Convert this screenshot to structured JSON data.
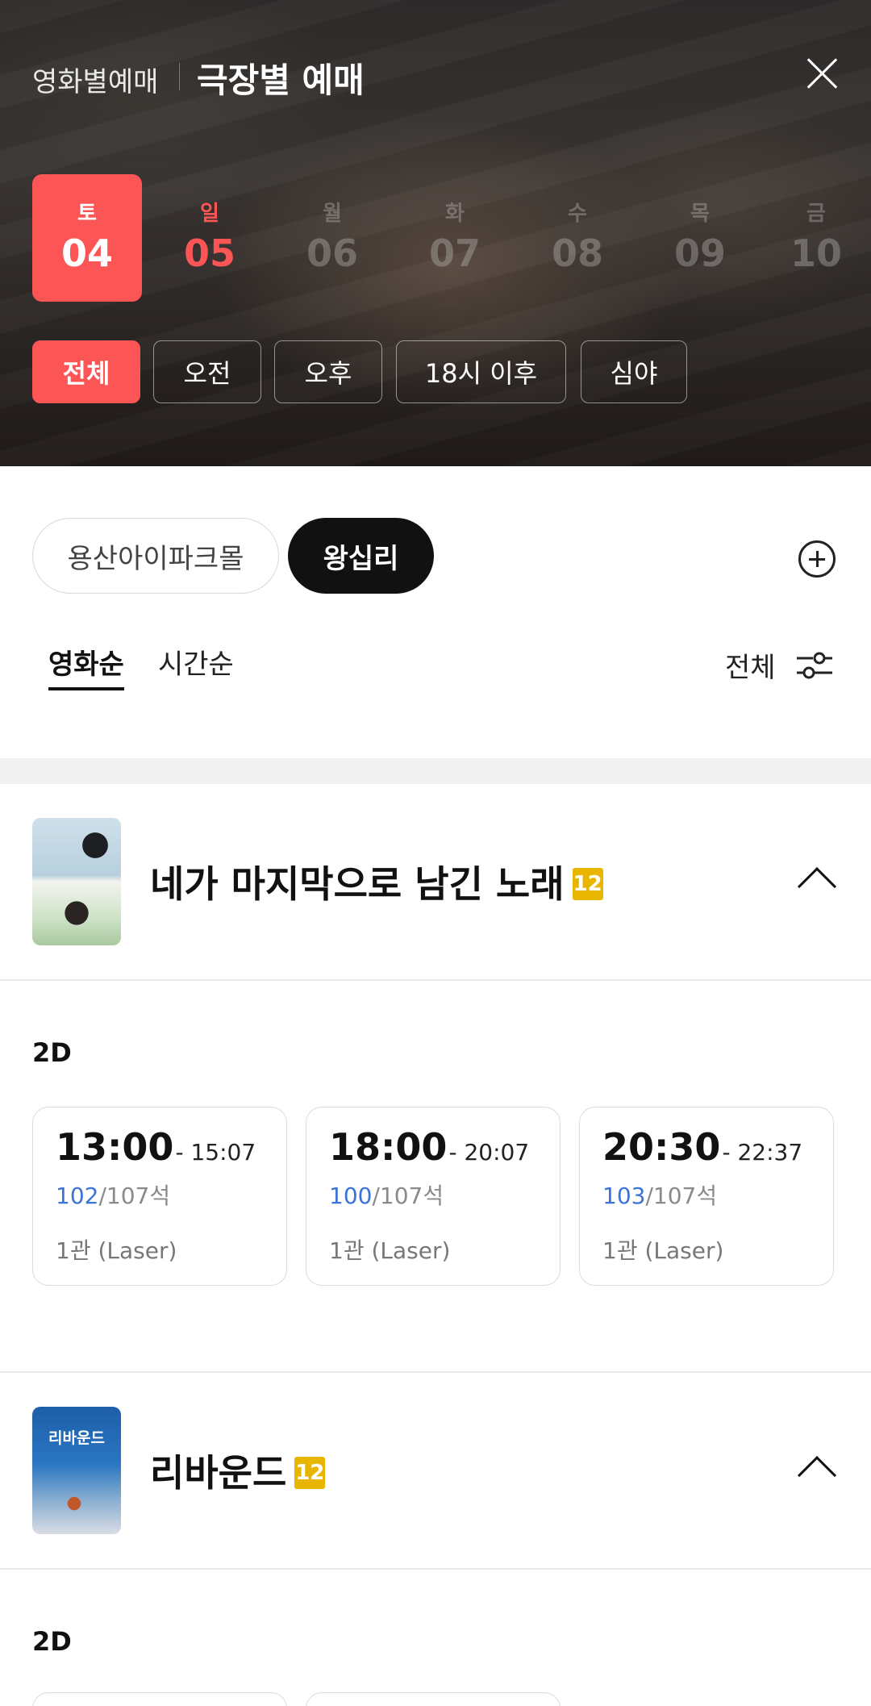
{
  "header": {
    "tab_movie": "영화별예매",
    "tab_theater": "극장별 예매"
  },
  "dates": [
    {
      "dow": "토",
      "day": "04",
      "state": "selected"
    },
    {
      "dow": "일",
      "day": "05",
      "state": "sunday"
    },
    {
      "dow": "월",
      "day": "06",
      "state": "dim"
    },
    {
      "dow": "화",
      "day": "07",
      "state": "dim"
    },
    {
      "dow": "수",
      "day": "08",
      "state": "dim"
    },
    {
      "dow": "목",
      "day": "09",
      "state": "dim"
    },
    {
      "dow": "금",
      "day": "10",
      "state": "dim"
    }
  ],
  "time_filters": [
    "전체",
    "오전",
    "오후",
    "18시 이후",
    "심야"
  ],
  "theaters": [
    "용산아이파크몰",
    "왕십리"
  ],
  "sort": {
    "by_movie": "영화순",
    "by_time": "시간순",
    "filter_label": "전체"
  },
  "movies": [
    {
      "poster_text": "",
      "title": "네가 마지막으로 남긴 노래",
      "age": "12",
      "format": "2D",
      "showtimes": [
        {
          "start": "13:00",
          "end": "- 15:07",
          "available": "102",
          "total": "/107석",
          "hall": "1관 (Laser)"
        },
        {
          "start": "18:00",
          "end": "- 20:07",
          "available": "100",
          "total": "/107석",
          "hall": "1관 (Laser)"
        },
        {
          "start": "20:30",
          "end": "- 22:37",
          "available": "103",
          "total": "/107석",
          "hall": "1관 (Laser)"
        }
      ]
    },
    {
      "poster_text": "리바운드",
      "title": "리바운드",
      "age": "12",
      "format": "2D"
    }
  ],
  "colors": {
    "accent": "#fb5556",
    "seat_available": "#3b73d6",
    "age_12": "#e8b500"
  }
}
